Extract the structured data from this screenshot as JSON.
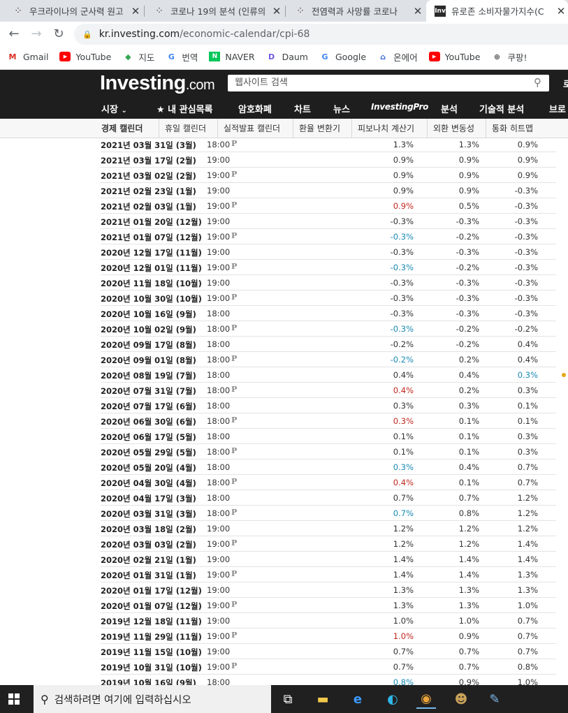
{
  "tabs": [
    {
      "title": "우크라이나의 군사력 원고",
      "icon": "dots-icon"
    },
    {
      "title": "코로나 19의 분석 (인류의",
      "icon": "dots-icon"
    },
    {
      "title": "전염력과 사망률 코로나",
      "icon": "dots-icon"
    },
    {
      "title": "유로존 소비자물가지수(C",
      "icon": "investing-icon",
      "icon_text": "Inv"
    }
  ],
  "address": {
    "host": "kr.investing.com",
    "path": "/economic-calendar/cpi-68"
  },
  "bookmarks": [
    {
      "label": "Gmail",
      "icon": "gmail-icon"
    },
    {
      "label": "YouTube",
      "icon": "youtube-icon"
    },
    {
      "label": "지도",
      "icon": "maps-icon"
    },
    {
      "label": "번역",
      "icon": "translate-icon"
    },
    {
      "label": "NAVER",
      "icon": "naver-icon"
    },
    {
      "label": "Daum",
      "icon": "daum-icon"
    },
    {
      "label": "Google",
      "icon": "google-icon"
    },
    {
      "label": "온에어",
      "icon": "onair-icon"
    },
    {
      "label": "YouTube",
      "icon": "youtube-icon"
    },
    {
      "label": "쿠팡!",
      "icon": "coupang-icon"
    }
  ],
  "site": {
    "logo_main": "Investing",
    "logo_suffix": ".com",
    "search_placeholder": "웹사이트 검색",
    "header_edge": "로",
    "nav": [
      "시장",
      "★ 내 관심목록",
      "암호화폐",
      "차트",
      "뉴스",
      "InvestingPro",
      "분석",
      "기술적 분석",
      "브로"
    ],
    "subnav": [
      "경제 캘린더",
      "휴일 캘린더",
      "실적발표 캘린더",
      "환율 변환기",
      "피보나치 계산기",
      "외환 변동성",
      "통화 히트맵"
    ]
  },
  "rows": [
    {
      "date": "2021년 03월 31일 (3월)",
      "time": "18:00",
      "p": true,
      "actual": "1.3%",
      "forecast": "1.3%",
      "previous": "0.9%",
      "ac": ""
    },
    {
      "date": "2021년 03월 17일 (2월)",
      "time": "19:00",
      "p": false,
      "actual": "0.9%",
      "forecast": "0.9%",
      "previous": "0.9%",
      "ac": ""
    },
    {
      "date": "2021년 03월 02일 (2월)",
      "time": "19:00",
      "p": true,
      "actual": "0.9%",
      "forecast": "0.9%",
      "previous": "0.9%",
      "ac": ""
    },
    {
      "date": "2021년 02월 23일 (1월)",
      "time": "19:00",
      "p": false,
      "actual": "0.9%",
      "forecast": "0.9%",
      "previous": "-0.3%",
      "ac": ""
    },
    {
      "date": "2021년 02월 03일 (1월)",
      "time": "19:00",
      "p": true,
      "actual": "0.9%",
      "forecast": "0.5%",
      "previous": "-0.3%",
      "ac": "red"
    },
    {
      "date": "2021년 01월 20일 (12월)",
      "time": "19:00",
      "p": false,
      "actual": "-0.3%",
      "forecast": "-0.3%",
      "previous": "-0.3%",
      "ac": ""
    },
    {
      "date": "2021년 01월 07일 (12월)",
      "time": "19:00",
      "p": true,
      "actual": "-0.3%",
      "forecast": "-0.2%",
      "previous": "-0.3%",
      "ac": "blue"
    },
    {
      "date": "2020년 12월 17일 (11월)",
      "time": "19:00",
      "p": false,
      "actual": "-0.3%",
      "forecast": "-0.3%",
      "previous": "-0.3%",
      "ac": ""
    },
    {
      "date": "2020년 12월 01일 (11월)",
      "time": "19:00",
      "p": true,
      "actual": "-0.3%",
      "forecast": "-0.2%",
      "previous": "-0.3%",
      "ac": "blue"
    },
    {
      "date": "2020년 11월 18일 (10월)",
      "time": "19:00",
      "p": false,
      "actual": "-0.3%",
      "forecast": "-0.3%",
      "previous": "-0.3%",
      "ac": ""
    },
    {
      "date": "2020년 10월 30일 (10월)",
      "time": "19:00",
      "p": true,
      "actual": "-0.3%",
      "forecast": "-0.3%",
      "previous": "-0.3%",
      "ac": ""
    },
    {
      "date": "2020년 10월 16일 (9월)",
      "time": "18:00",
      "p": false,
      "actual": "-0.3%",
      "forecast": "-0.3%",
      "previous": "-0.3%",
      "ac": ""
    },
    {
      "date": "2020년 10월 02일 (9월)",
      "time": "18:00",
      "p": true,
      "actual": "-0.3%",
      "forecast": "-0.2%",
      "previous": "-0.2%",
      "ac": "blue"
    },
    {
      "date": "2020년 09월 17일 (8월)",
      "time": "18:00",
      "p": false,
      "actual": "-0.2%",
      "forecast": "-0.2%",
      "previous": "0.4%",
      "ac": ""
    },
    {
      "date": "2020년 09월 01일 (8월)",
      "time": "18:00",
      "p": true,
      "actual": "-0.2%",
      "forecast": "0.2%",
      "previous": "0.4%",
      "ac": "blue"
    },
    {
      "date": "2020년 08월 19일 (7월)",
      "time": "18:00",
      "p": false,
      "actual": "0.4%",
      "forecast": "0.4%",
      "previous": "0.3%",
      "ac": "",
      "pc": "blue",
      "dot": true
    },
    {
      "date": "2020년 07월 31일 (7월)",
      "time": "18:00",
      "p": true,
      "actual": "0.4%",
      "forecast": "0.2%",
      "previous": "0.3%",
      "ac": "red"
    },
    {
      "date": "2020년 07월 17일 (6월)",
      "time": "18:00",
      "p": false,
      "actual": "0.3%",
      "forecast": "0.3%",
      "previous": "0.1%",
      "ac": ""
    },
    {
      "date": "2020년 06월 30일 (6월)",
      "time": "18:00",
      "p": true,
      "actual": "0.3%",
      "forecast": "0.1%",
      "previous": "0.1%",
      "ac": "red"
    },
    {
      "date": "2020년 06월 17일 (5월)",
      "time": "18:00",
      "p": false,
      "actual": "0.1%",
      "forecast": "0.1%",
      "previous": "0.3%",
      "ac": ""
    },
    {
      "date": "2020년 05월 29일 (5월)",
      "time": "18:00",
      "p": true,
      "actual": "0.1%",
      "forecast": "0.1%",
      "previous": "0.3%",
      "ac": ""
    },
    {
      "date": "2020년 05월 20일 (4월)",
      "time": "18:00",
      "p": false,
      "actual": "0.3%",
      "forecast": "0.4%",
      "previous": "0.7%",
      "ac": "blue"
    },
    {
      "date": "2020년 04월 30일 (4월)",
      "time": "18:00",
      "p": true,
      "actual": "0.4%",
      "forecast": "0.1%",
      "previous": "0.7%",
      "ac": "red"
    },
    {
      "date": "2020년 04월 17일 (3월)",
      "time": "18:00",
      "p": false,
      "actual": "0.7%",
      "forecast": "0.7%",
      "previous": "1.2%",
      "ac": ""
    },
    {
      "date": "2020년 03월 31일 (3월)",
      "time": "18:00",
      "p": true,
      "actual": "0.7%",
      "forecast": "0.8%",
      "previous": "1.2%",
      "ac": "blue"
    },
    {
      "date": "2020년 03월 18일 (2월)",
      "time": "19:00",
      "p": false,
      "actual": "1.2%",
      "forecast": "1.2%",
      "previous": "1.2%",
      "ac": ""
    },
    {
      "date": "2020년 03월 03일 (2월)",
      "time": "19:00",
      "p": true,
      "actual": "1.2%",
      "forecast": "1.2%",
      "previous": "1.4%",
      "ac": ""
    },
    {
      "date": "2020년 02월 21일 (1월)",
      "time": "19:00",
      "p": false,
      "actual": "1.4%",
      "forecast": "1.4%",
      "previous": "1.4%",
      "ac": ""
    },
    {
      "date": "2020년 01월 31일 (1월)",
      "time": "19:00",
      "p": true,
      "actual": "1.4%",
      "forecast": "1.4%",
      "previous": "1.3%",
      "ac": ""
    },
    {
      "date": "2020년 01월 17일 (12월)",
      "time": "19:00",
      "p": false,
      "actual": "1.3%",
      "forecast": "1.3%",
      "previous": "1.3%",
      "ac": ""
    },
    {
      "date": "2020년 01월 07일 (12월)",
      "time": "19:00",
      "p": true,
      "actual": "1.3%",
      "forecast": "1.3%",
      "previous": "1.0%",
      "ac": ""
    },
    {
      "date": "2019년 12월 18일 (11월)",
      "time": "19:00",
      "p": false,
      "actual": "1.0%",
      "forecast": "1.0%",
      "previous": "0.7%",
      "ac": ""
    },
    {
      "date": "2019년 11월 29일 (11월)",
      "time": "19:00",
      "p": true,
      "actual": "1.0%",
      "forecast": "0.9%",
      "previous": "0.7%",
      "ac": "red"
    },
    {
      "date": "2019년 11월 15일 (10월)",
      "time": "19:00",
      "p": false,
      "actual": "0.7%",
      "forecast": "0.7%",
      "previous": "0.7%",
      "ac": ""
    },
    {
      "date": "2019년 10월 31일 (10월)",
      "time": "19:00",
      "p": true,
      "actual": "0.7%",
      "forecast": "0.7%",
      "previous": "0.8%",
      "ac": ""
    },
    {
      "date": "2019년 10월 16일 (9월)",
      "time": "18:00",
      "p": false,
      "actual": "0.8%",
      "forecast": "0.9%",
      "previous": "1.0%",
      "ac": "blue"
    }
  ],
  "prelim_mark": "P",
  "taskbar": {
    "search_placeholder": "검색하려면 여기에 입력하십시오"
  },
  "colors": {
    "up": "#c0281e",
    "down": "#1a8ab3",
    "header_bg": "#1e1e1e"
  }
}
